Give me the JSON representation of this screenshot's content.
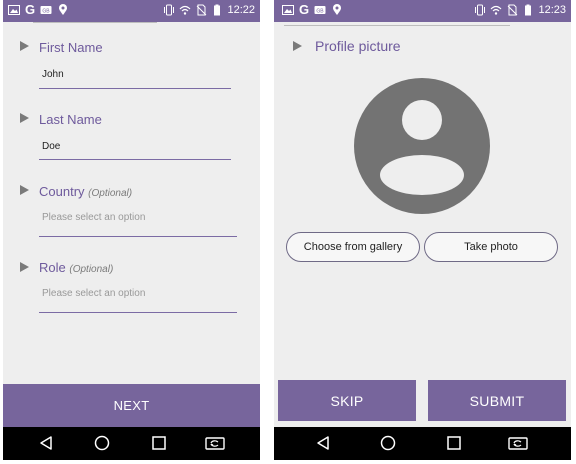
{
  "screen1": {
    "status_time": "12:22",
    "fields": [
      {
        "label": "First Name",
        "optional": "",
        "value": "John",
        "placeholder": ""
      },
      {
        "label": "Last Name",
        "optional": "",
        "value": "Doe",
        "placeholder": ""
      },
      {
        "label": "Country",
        "optional": "(Optional)",
        "value": "",
        "placeholder": "Please select an option"
      },
      {
        "label": "Role",
        "optional": "(Optional)",
        "value": "",
        "placeholder": "Please select an option"
      }
    ],
    "next_label": "NEXT"
  },
  "screen2": {
    "status_time": "12:23",
    "section_label": "Profile picture",
    "gallery_label": "Choose from gallery",
    "photo_label": "Take photo",
    "skip_label": "SKIP",
    "submit_label": "SUBMIT"
  },
  "colors": {
    "accent": "#77659c",
    "label": "#6e5a9c",
    "background": "#eeeeee",
    "avatar": "#737373"
  },
  "icons": {
    "status_left": [
      "image-icon",
      "google-icon",
      "cast-icon",
      "location-icon"
    ],
    "status_right": [
      "vibrate-icon",
      "wifi-icon",
      "no-sim-icon",
      "battery-icon"
    ],
    "nav": [
      "back-icon",
      "home-icon",
      "recents-icon",
      "screen-rotate-icon"
    ]
  }
}
